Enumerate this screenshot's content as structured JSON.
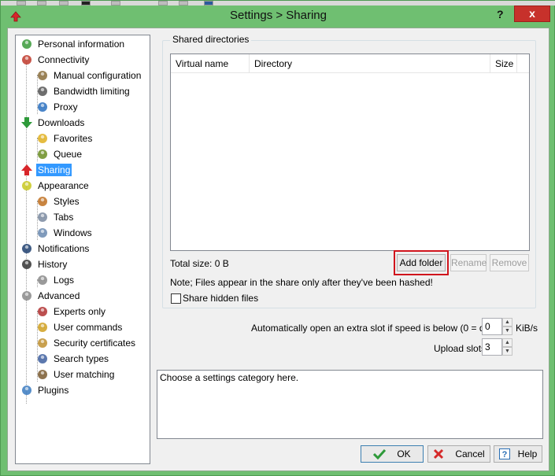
{
  "window": {
    "title": "Settings > Sharing",
    "help_glyph": "?",
    "close_glyph": "x"
  },
  "tree": {
    "items": [
      {
        "label": "Personal information",
        "icon": "person-icon"
      },
      {
        "label": "Connectivity",
        "icon": "antenna-icon"
      },
      {
        "label": "Manual configuration",
        "icon": "antenna-config-icon"
      },
      {
        "label": "Bandwidth limiting",
        "icon": "gauge-icon"
      },
      {
        "label": "Proxy",
        "icon": "globe-icon"
      },
      {
        "label": "Downloads",
        "icon": "green-arrow-down-icon"
      },
      {
        "label": "Favorites",
        "icon": "star-icon"
      },
      {
        "label": "Queue",
        "icon": "queue-icon"
      },
      {
        "label": "Sharing",
        "icon": "red-arrow-up-icon",
        "selected": true
      },
      {
        "label": "Appearance",
        "icon": "palette-icon"
      },
      {
        "label": "Styles",
        "icon": "paint-icon"
      },
      {
        "label": "Tabs",
        "icon": "tabs-icon"
      },
      {
        "label": "Windows",
        "icon": "windows-icon"
      },
      {
        "label": "Notifications",
        "icon": "globe-dark-icon"
      },
      {
        "label": "History",
        "icon": "clock-icon"
      },
      {
        "label": "Logs",
        "icon": "pen-icon"
      },
      {
        "label": "Advanced",
        "icon": "cog-icon"
      },
      {
        "label": "Experts only",
        "icon": "tools-icon"
      },
      {
        "label": "User commands",
        "icon": "key-icon"
      },
      {
        "label": "Security certificates",
        "icon": "lock-icon"
      },
      {
        "label": "Search types",
        "icon": "magnifier-icon"
      },
      {
        "label": "User matching",
        "icon": "users-icon"
      },
      {
        "label": "Plugins",
        "icon": "puzzle-icon"
      }
    ]
  },
  "sharing": {
    "group_title": "Shared directories",
    "columns": [
      "Virtual name",
      "Directory",
      "Size"
    ],
    "total_size": "Total size: 0 B",
    "add_folder": "Add folder",
    "rename": "Rename",
    "remove": "Remove",
    "note": "Note; Files appear in the share only after they've been hashed!",
    "share_hidden": "Share hidden files",
    "share_hidden_checked": false,
    "extra_slot_label": "Automatically open an extra slot if speed is below (0 = disable)",
    "extra_slot_value": "0",
    "extra_slot_unit": "KiB/s",
    "upload_slots_label": "Upload slots",
    "upload_slots_value": "3"
  },
  "description": "Choose a settings category here.",
  "buttons": {
    "ok": "OK",
    "cancel": "Cancel",
    "help": "Help"
  },
  "colors": {
    "frame": "#6fbf71",
    "selection": "#3399ff",
    "highlight": "#d0141c"
  }
}
